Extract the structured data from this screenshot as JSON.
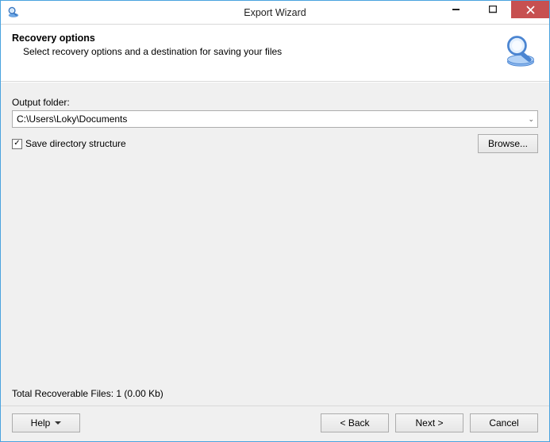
{
  "window": {
    "title": "Export Wizard"
  },
  "header": {
    "title": "Recovery options",
    "subtitle": "Select recovery options and a destination for saving your files"
  },
  "fields": {
    "output_folder_label": "Output folder:",
    "output_folder_value": "C:\\Users\\Loky\\Documents",
    "save_dir_label": "Save directory structure",
    "save_dir_checked": "✓",
    "browse_label": "Browse..."
  },
  "status": {
    "text": "Total Recoverable Files: 1 (0.00 Kb)"
  },
  "buttons": {
    "help": "Help",
    "back": "< Back",
    "next": "Next >",
    "cancel": "Cancel"
  }
}
